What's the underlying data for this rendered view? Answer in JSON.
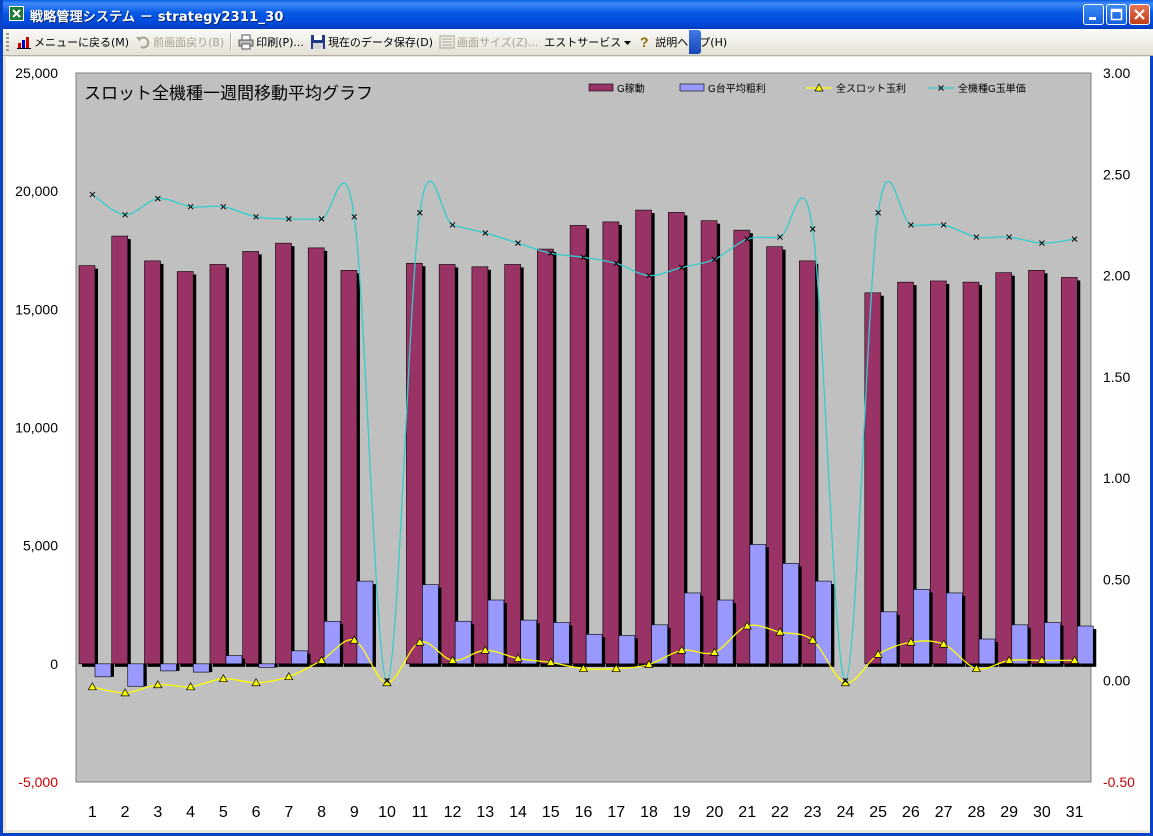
{
  "window": {
    "title": "戦略管理システム － strategy2311_30",
    "icon": "excel-app-icon"
  },
  "toolbar": {
    "items": [
      {
        "label": "メニューに戻る(M)",
        "icon": "menu-chart-icon",
        "enabled": true
      },
      {
        "label": "前画面戻り(B)",
        "icon": "undo-arrow-icon",
        "enabled": false
      },
      {
        "label": "印刷(P)...",
        "icon": "printer-icon",
        "enabled": true
      },
      {
        "label": "現在のデータ保存(D)",
        "icon": "floppy-disk-icon",
        "enabled": true
      },
      {
        "label": "画面サイズ(Z)...",
        "icon": "screen-size-icon",
        "enabled": false
      },
      {
        "label": "エストサービス",
        "icon": "dropdown-arrow-icon",
        "enabled": true
      },
      {
        "label": "説明ヘルプ(H)",
        "icon": "help-question-icon",
        "enabled": true
      }
    ]
  },
  "chart_data": {
    "type": "bar",
    "title": "スロット全機種一週間移動平均グラフ",
    "categories": [
      "1",
      "2",
      "3",
      "4",
      "5",
      "6",
      "7",
      "8",
      "9",
      "10",
      "11",
      "12",
      "13",
      "14",
      "15",
      "16",
      "17",
      "18",
      "19",
      "20",
      "21",
      "22",
      "23",
      "24",
      "25",
      "26",
      "27",
      "28",
      "29",
      "30",
      "31"
    ],
    "ylim": [
      -5000,
      25000
    ],
    "y2lim": [
      -0.5,
      3.0
    ],
    "y_ticks": [
      "25,000",
      "20,000",
      "15,000",
      "10,000",
      "5,000",
      "0",
      "-5,000"
    ],
    "y2_ticks": [
      "3.00",
      "2.50",
      "2.00",
      "1.50",
      "1.00",
      "0.50",
      "0.00",
      "-0.50"
    ],
    "grid": false,
    "legend_position": "top-right",
    "colors": {
      "plot_bg": "#C0C0C0",
      "g_kadou": "#993366",
      "g_avg_profit": "#9999FF",
      "slot_profit_line": "#FFFF00",
      "slot_profit_marker": "#FFFF00",
      "unit_price_line": "#33CCCC",
      "negative_tick": "#CC0000"
    },
    "series": [
      {
        "name": "G稼動",
        "type": "bar",
        "axis": "left",
        "values": [
          16850,
          18100,
          17050,
          16600,
          16900,
          17450,
          17800,
          17600,
          16650,
          0,
          16950,
          16900,
          16800,
          16900,
          17550,
          18550,
          18700,
          19200,
          19100,
          18750,
          18350,
          17650,
          17050,
          0,
          15700,
          16150,
          16200,
          16150,
          16550,
          16650,
          16350
        ]
      },
      {
        "name": "G台平均粗利",
        "type": "bar",
        "axis": "left",
        "values": [
          -550,
          -950,
          -300,
          -350,
          350,
          -150,
          550,
          1800,
          3500,
          0,
          3350,
          1800,
          2700,
          1850,
          1750,
          1250,
          1200,
          1650,
          3000,
          2700,
          5050,
          4250,
          3500,
          0,
          2200,
          3150,
          3000,
          1050,
          1650,
          1750,
          1600
        ]
      },
      {
        "name": "全スロット玉利",
        "type": "line",
        "axis": "right",
        "values": [
          -0.03,
          -0.06,
          -0.02,
          -0.03,
          0.01,
          -0.01,
          0.02,
          0.1,
          0.2,
          -0.01,
          0.19,
          0.1,
          0.15,
          0.11,
          0.09,
          0.06,
          0.06,
          0.08,
          0.15,
          0.14,
          0.27,
          0.24,
          0.2,
          -0.01,
          0.13,
          0.19,
          0.18,
          0.06,
          0.1,
          0.1,
          0.1
        ]
      },
      {
        "name": "全機種G玉単価",
        "type": "line",
        "axis": "right",
        "values": [
          2.4,
          2.3,
          2.38,
          2.34,
          2.34,
          2.29,
          2.28,
          2.28,
          2.29,
          0.0,
          2.31,
          2.25,
          2.21,
          2.16,
          2.11,
          2.09,
          2.06,
          2.0,
          2.04,
          2.08,
          2.18,
          2.19,
          2.23,
          0.0,
          2.31,
          2.25,
          2.25,
          2.19,
          2.19,
          2.16,
          2.18
        ]
      }
    ]
  }
}
